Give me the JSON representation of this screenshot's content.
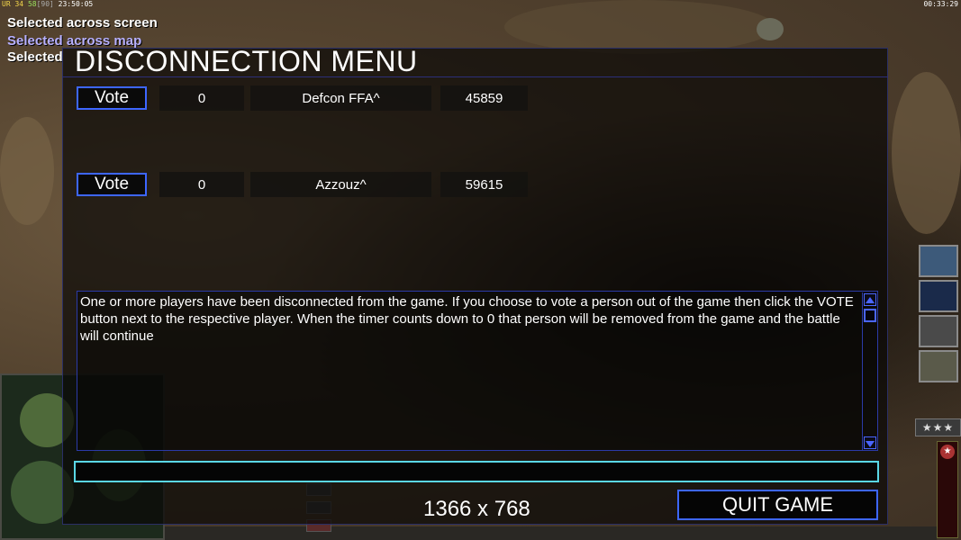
{
  "hud": {
    "top_left": {
      "p1": "UR",
      "p2": "34",
      "p3": "58",
      "p4": "[90]",
      "p5": "23:50:05"
    },
    "top_right_time": "00:33:29",
    "messages": [
      {
        "text": "Selected across screen",
        "color": "#ffffff"
      },
      {
        "text": "Selected across map",
        "color": "#b7b0ff"
      },
      {
        "text": "Selected",
        "color": "#ffffff"
      }
    ],
    "rank_stars": "★★★"
  },
  "dialog": {
    "title": "DISCONNECTION MENU",
    "players": [
      {
        "vote_label": "Vote",
        "votes": "0",
        "name": "Defcon FFA^",
        "timer": "45859"
      },
      {
        "vote_label": "Vote",
        "votes": "0",
        "name": "Azzouz^",
        "timer": "59615"
      }
    ],
    "message": "One or more players have been disconnected from the game. If you choose to vote a person out of the game then click the VOTE button next to the respective player. When the timer counts down to 0 that person will be removed from the game and the battle will continue",
    "chat_value": "",
    "resolution": "1366 x 768",
    "quit_label": "QUIT GAME"
  },
  "colors": {
    "accent": "#3d66ff",
    "chat_border": "#5ad7e6"
  }
}
